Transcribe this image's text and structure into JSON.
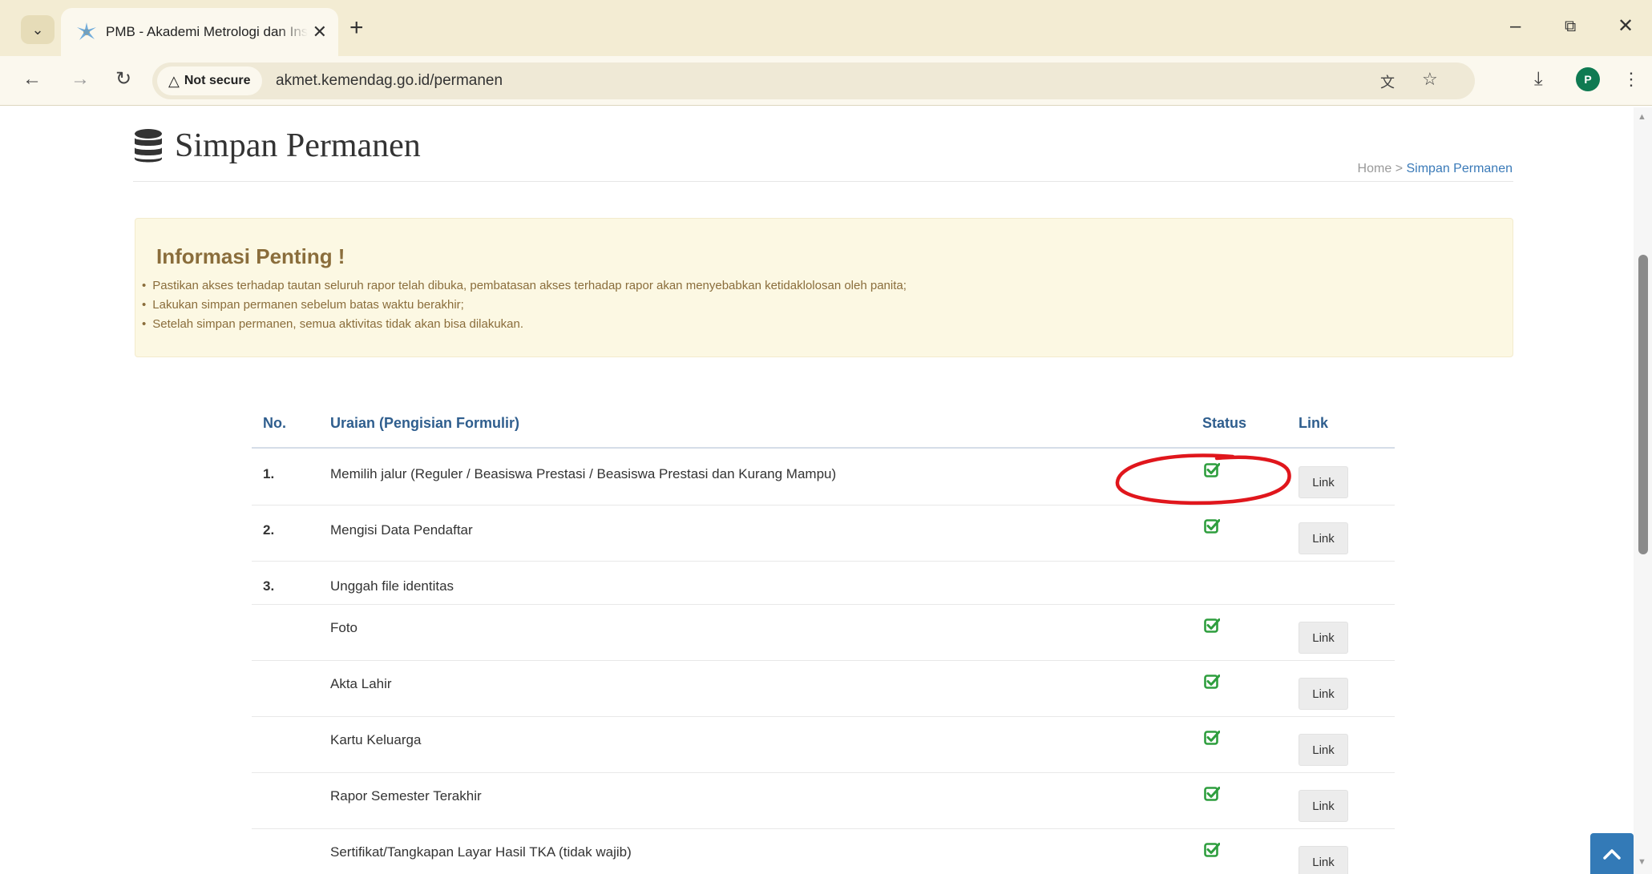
{
  "browser": {
    "tab_title": "PMB - Akademi Metrologi dan Instrumentasi",
    "security_label": "Not secure",
    "url": "akmet.kemendag.go.id/permanen",
    "profile_initial": "P"
  },
  "page": {
    "title": "Simpan Permanen",
    "breadcrumb": {
      "home": "Home",
      "separator": ">",
      "current": "Simpan Permanen"
    }
  },
  "alert": {
    "title": "Informasi Penting !",
    "items": [
      "Pastikan akses terhadap tautan seluruh rapor telah dibuka, pembatasan akses terhadap rapor akan menyebabkan ketidaklolosan oleh panita;",
      "Lakukan simpan permanen sebelum batas waktu berakhir;",
      "Setelah simpan permanen, semua aktivitas tidak akan bisa dilakukan."
    ]
  },
  "table": {
    "headers": {
      "no": "No.",
      "desc": "Uraian (Pengisian Formulir)",
      "status": "Status",
      "link": "Link"
    },
    "rows": [
      {
        "no": "1.",
        "desc": "Memilih jalur (Reguler / Beasiswa Prestasi / Beasiswa Prestasi dan Kurang Mampu)",
        "status": "checked",
        "link": "Link"
      },
      {
        "no": "2.",
        "desc": "Mengisi Data Pendaftar",
        "status": "checked",
        "link": "Link"
      },
      {
        "no": "3.",
        "desc": "Unggah file identitas"
      },
      {
        "no": "",
        "desc": "Foto",
        "status": "checked",
        "link": "Link"
      },
      {
        "no": "",
        "desc": "Akta Lahir",
        "status": "checked",
        "link": "Link"
      },
      {
        "no": "",
        "desc": "Kartu Keluarga",
        "status": "checked",
        "link": "Link"
      },
      {
        "no": "",
        "desc": "Rapor Semester Terakhir",
        "status": "checked",
        "link": "Link"
      },
      {
        "no": "",
        "desc": "Sertifikat/Tangkapan Layar Hasil TKA (tidak wajib)",
        "status": "checked",
        "link": "Link"
      }
    ]
  },
  "colors": {
    "accent": "#337ab7",
    "check": "#2e9e3e",
    "annotation": "#e0161c",
    "alert_bg": "#fcf8e3",
    "alert_text": "#8a6d3b"
  },
  "icons": [
    "database-icon",
    "check-square-icon",
    "chevron-up-icon",
    "star-icon",
    "download-icon",
    "translate-icon"
  ]
}
